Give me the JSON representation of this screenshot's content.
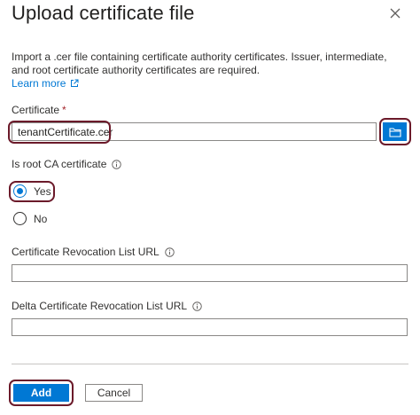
{
  "panel": {
    "title": "Upload certificate file",
    "description": "Import a .cer file containing certificate authority certificates. Issuer, intermediate, and root certificate authority certificates are required.",
    "learn_more": "Learn more"
  },
  "certificate": {
    "label": "Certificate",
    "required_mark": "*",
    "file_name": "tenantCertificate.cer"
  },
  "root_ca": {
    "label": "Is root CA certificate",
    "options": [
      {
        "label": "Yes",
        "checked": true
      },
      {
        "label": "No",
        "checked": false
      }
    ]
  },
  "revocation_url": {
    "label": "Certificate Revocation List URL",
    "value": ""
  },
  "delta_revocation_url": {
    "label": "Delta Certificate Revocation List URL",
    "value": ""
  },
  "footer": {
    "add_label": "Add",
    "cancel_label": "Cancel"
  },
  "colors": {
    "accent": "#0078d4",
    "highlight": "#6b1a2a",
    "required": "#a4262c"
  },
  "icons": {
    "close": "close-icon",
    "external_link": "external-link-icon",
    "info": "info-icon",
    "folder": "folder-icon"
  }
}
